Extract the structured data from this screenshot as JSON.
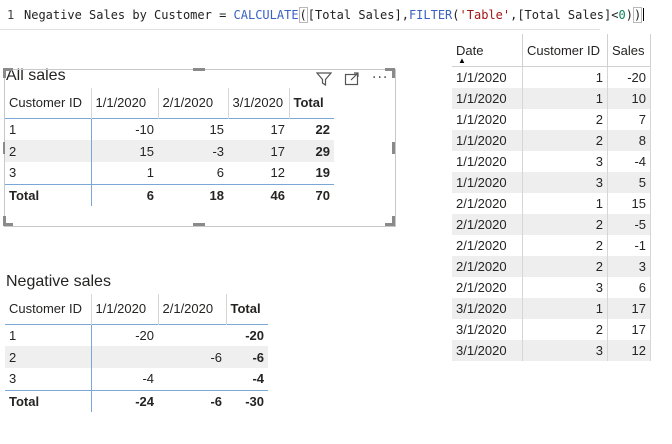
{
  "formula": {
    "line_number": "1",
    "measure_name": "Negative Sales by Customer = ",
    "fn_calculate": "CALCULATE",
    "arg1": "[Total Sales],",
    "fn_filter": "FILTER",
    "table_ref": "'Table'",
    "arg2_a": ",[Total Sales]<",
    "zero": "0",
    "close": "))"
  },
  "all_sales": {
    "title": "All sales",
    "headers": [
      "Customer ID",
      "1/1/2020",
      "2/1/2020",
      "3/1/2020",
      "Total"
    ],
    "rows": [
      [
        "1",
        "-10",
        "15",
        "17",
        "22"
      ],
      [
        "2",
        "15",
        "-3",
        "17",
        "29"
      ],
      [
        "3",
        "1",
        "6",
        "12",
        "19"
      ]
    ],
    "total": [
      "Total",
      "6",
      "18",
      "46",
      "70"
    ],
    "toolbar": {
      "filter_icon": "filter-icon",
      "focus_icon": "focus-mode-icon",
      "more_icon": "more-options-icon"
    }
  },
  "negative_sales": {
    "title": "Negative sales",
    "headers": [
      "Customer ID",
      "1/1/2020",
      "2/1/2020",
      "Total"
    ],
    "rows": [
      [
        "1",
        "-20",
        "",
        "-20"
      ],
      [
        "2",
        "",
        "-6",
        "-6"
      ],
      [
        "3",
        "-4",
        "",
        "-4"
      ]
    ],
    "total": [
      "Total",
      "-24",
      "-6",
      "-30"
    ]
  },
  "data_view": {
    "headers": [
      "Date",
      "Customer ID",
      "Sales"
    ],
    "rows": [
      [
        "1/1/2020",
        "1",
        "-20"
      ],
      [
        "1/1/2020",
        "1",
        "10"
      ],
      [
        "1/1/2020",
        "2",
        "7"
      ],
      [
        "1/1/2020",
        "2",
        "8"
      ],
      [
        "1/1/2020",
        "3",
        "-4"
      ],
      [
        "1/1/2020",
        "3",
        "5"
      ],
      [
        "2/1/2020",
        "1",
        "15"
      ],
      [
        "2/1/2020",
        "2",
        "-5"
      ],
      [
        "2/1/2020",
        "2",
        "-1"
      ],
      [
        "2/1/2020",
        "2",
        "3"
      ],
      [
        "2/1/2020",
        "3",
        "6"
      ],
      [
        "3/1/2020",
        "1",
        "17"
      ],
      [
        "3/1/2020",
        "2",
        "17"
      ],
      [
        "3/1/2020",
        "3",
        "12"
      ]
    ]
  }
}
